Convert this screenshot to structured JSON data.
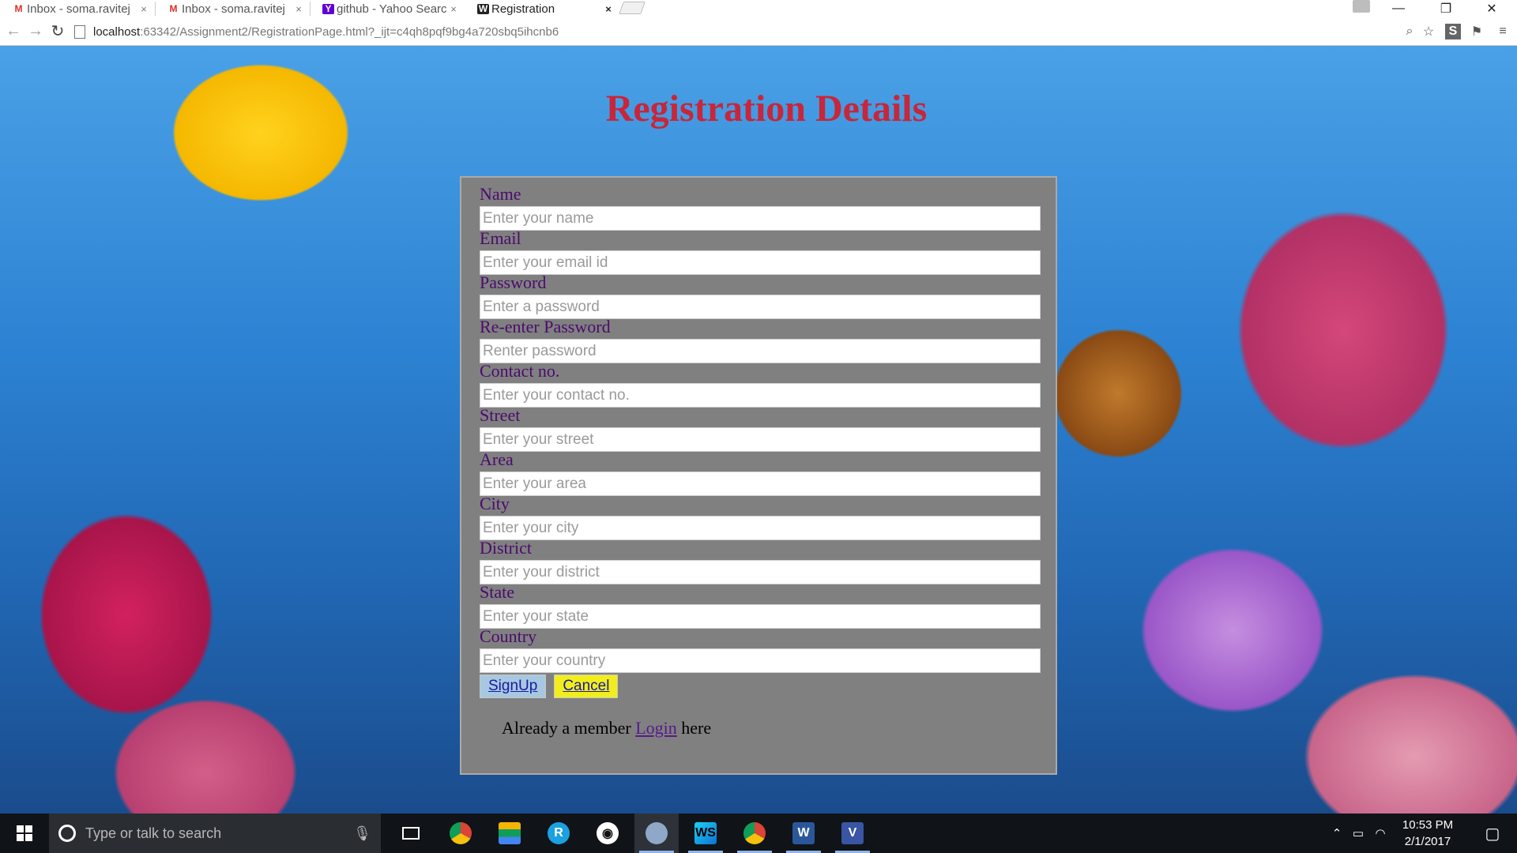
{
  "browser": {
    "tabs": [
      {
        "title": "Inbox - soma.ravitej",
        "icon": "gmail-icon",
        "icon_color": "#d93025",
        "icon_glyph": "M"
      },
      {
        "title": "Inbox - soma.ravitej",
        "icon": "gmail-icon",
        "icon_color": "#d93025",
        "icon_glyph": "M"
      },
      {
        "title": "github - Yahoo Searc",
        "icon": "yahoo-icon",
        "icon_color": "#6001d2",
        "icon_glyph": "Y"
      },
      {
        "title": "Registration",
        "icon": "webstorm-icon",
        "icon_color": "#222222",
        "icon_glyph": "W",
        "active": true
      }
    ],
    "tab_close": "×",
    "url_host": "localhost",
    "url_path": ":63342/Assignment2/RegistrationPage.html?_ijt=c4qh8pqf9bg4a720sbq5ihcnb6",
    "window_controls": {
      "minimize": "—",
      "restore": "❐",
      "close": "✕"
    }
  },
  "page": {
    "title": "Registration Details",
    "fields": [
      {
        "label": "Name",
        "placeholder": "Enter your name"
      },
      {
        "label": "Email",
        "placeholder": "Enter your email id"
      },
      {
        "label": "Password",
        "placeholder": "Enter a password"
      },
      {
        "label": "Re-enter Password",
        "placeholder": "Renter password"
      },
      {
        "label": "Contact no.",
        "placeholder": "Enter your contact no."
      },
      {
        "label": "Street",
        "placeholder": "Enter your street"
      },
      {
        "label": "Area",
        "placeholder": "Enter your area"
      },
      {
        "label": "City",
        "placeholder": "Enter your city"
      },
      {
        "label": "District",
        "placeholder": "Enter your district"
      },
      {
        "label": "State",
        "placeholder": "Enter your state"
      },
      {
        "label": "Country",
        "placeholder": "Enter your country"
      }
    ],
    "signup_label": "SignUp",
    "cancel_label": "Cancel",
    "member_prefix": "Already a member",
    "login_link": "Login",
    "member_suffix": "here",
    "colors": {
      "title": "#c8263a",
      "label": "#4b0b6e",
      "panel": "#808080",
      "signup_bg": "#a7c8e0",
      "cancel_bg": "#f2ee1c"
    }
  },
  "taskbar": {
    "search_placeholder": "Type or talk to search",
    "apps": [
      "task-view-icon",
      "chrome-icon",
      "stack-app-icon",
      "r-app-icon",
      "github-icon",
      "chrome-icon",
      "webstorm-icon",
      "chrome-icon",
      "word-icon",
      "visio-icon"
    ],
    "time": "10:53 PM",
    "date": "2/1/2017"
  }
}
